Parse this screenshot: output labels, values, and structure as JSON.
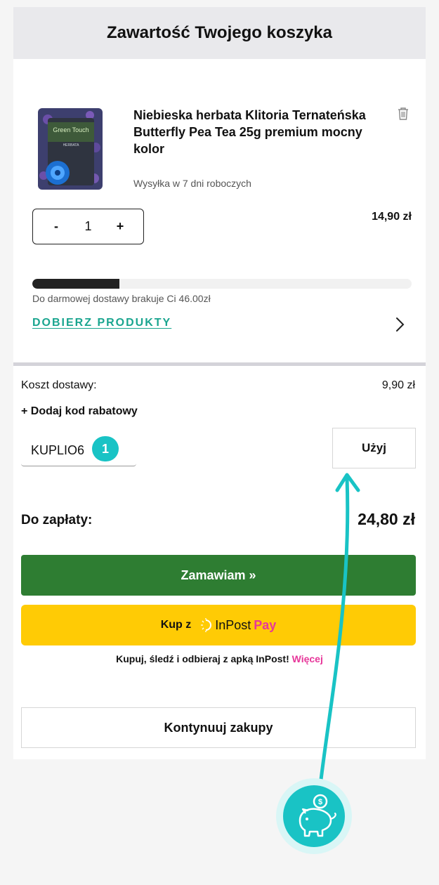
{
  "header": {
    "title": "Zawartość Twojego koszyka"
  },
  "product": {
    "title": "Niebieska herbata Klitoria Ternateńska Butterfly Pea Tea 25g premium mocny kolor",
    "image_label": "Green Touch",
    "image_sublabel": "HERBATA",
    "shipping": "Wysyłka w 7 dni roboczych",
    "price": "14,90 zł",
    "quantity": "1",
    "qty_minus": "-",
    "qty_plus": "+"
  },
  "free_shipping": {
    "progress_fraction": 0.23,
    "text": "Do darmowej dostawy brakuje Ci 46.00zł",
    "link": "DOBIERZ PRODUKTY"
  },
  "summary": {
    "shipping_label": "Koszt dostawy:",
    "shipping_value": "9,90 zł",
    "add_code": "+ Dodaj kod rabatowy",
    "code_value": "KUPLIO6",
    "badge": "1",
    "apply": "Użyj",
    "total_label": "Do zapłaty:",
    "total_value": "24,80 zł"
  },
  "actions": {
    "order": "Zamawiam »",
    "inpost_prefix": "Kup z",
    "inpost_brand_in": "InPost",
    "inpost_brand_pay": "Pay",
    "inpost_note": "Kupuj, śledź i odbieraj z apką InPost! ",
    "inpost_more": "Więcej",
    "continue": "Kontynuuj zakupy"
  },
  "colors": {
    "accent_teal": "#19c3c5",
    "order_green": "#2e7d32",
    "inpost_yellow": "#ffcb05",
    "inpost_pink": "#e7379a",
    "link_teal": "#1aa58f"
  }
}
